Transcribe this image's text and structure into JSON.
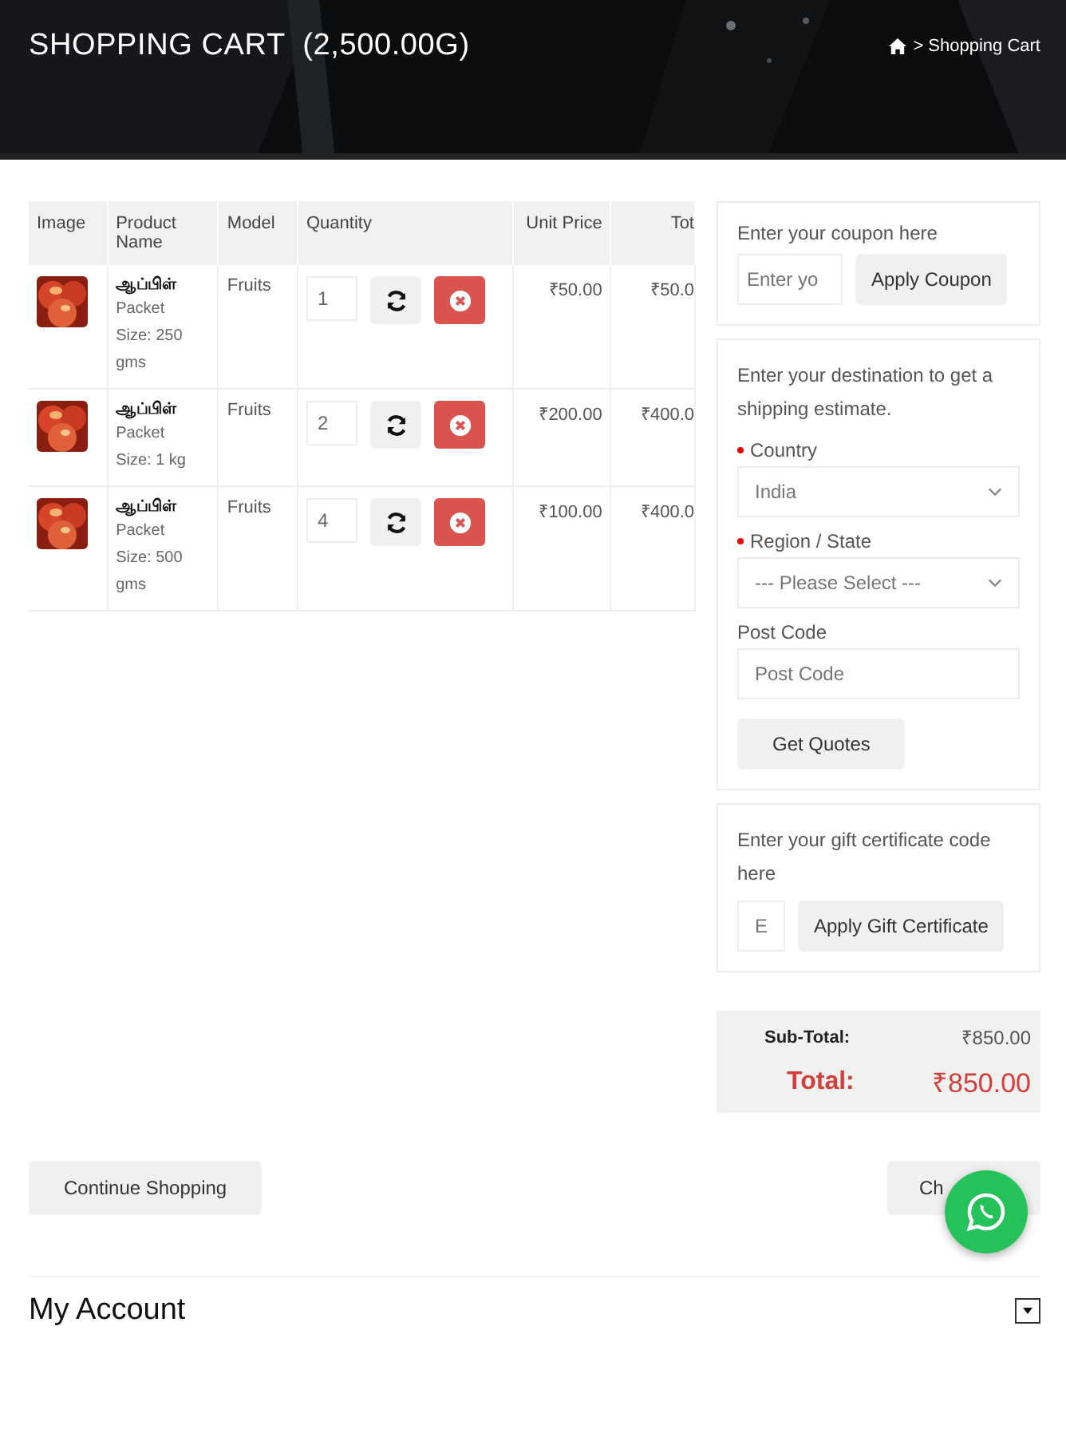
{
  "header": {
    "title": "SHOPPING CART  (2,500.00G)",
    "breadcrumb": "> Shopping Cart"
  },
  "cart": {
    "columns": [
      "Image",
      "Product Name",
      "Model",
      "Quantity",
      "Unit Price",
      "Tot"
    ],
    "rows": [
      {
        "name": "ஆப்பிள்",
        "option": "Packet",
        "size": "Size: 250 gms",
        "model": "Fruits",
        "quantity": "1",
        "unit_price": "₹50.00",
        "total": "₹50.0"
      },
      {
        "name": "ஆப்பிள்",
        "option": "Packet",
        "size": "Size: 1 kg",
        "model": "Fruits",
        "quantity": "2",
        "unit_price": "₹200.00",
        "total": "₹400.0"
      },
      {
        "name": "ஆப்பிள்",
        "option": "Packet",
        "size": "Size: 500 gms",
        "model": "Fruits",
        "quantity": "4",
        "unit_price": "₹100.00",
        "total": "₹400.0"
      }
    ]
  },
  "coupon": {
    "label": "Enter your coupon here",
    "placeholder": "Enter yo",
    "button": "Apply Coupon"
  },
  "shipping": {
    "intro": "Enter your destination to get a shipping estimate.",
    "fields": [
      {
        "kind": "select",
        "label": "Country",
        "required": true,
        "value": "India"
      },
      {
        "kind": "select",
        "label": "Region / State",
        "required": true,
        "value": "--- Please Select ---"
      },
      {
        "kind": "input",
        "label": "Post Code",
        "required": false,
        "placeholder": "Post Code"
      }
    ],
    "button": "Get Quotes"
  },
  "gift": {
    "label": "Enter your gift certificate code here",
    "placeholder": "E",
    "button": "Apply Gift Certificate"
  },
  "totals": [
    {
      "kind": "subtotal",
      "label": "Sub-Total:",
      "value": "₹850.00"
    },
    {
      "kind": "total",
      "label": "Total:",
      "value": "₹850.00"
    }
  ],
  "buttons": {
    "continue": "Continue Shopping",
    "checkout": "Ch"
  },
  "footer": {
    "title": "My Account",
    "expanded": false
  }
}
